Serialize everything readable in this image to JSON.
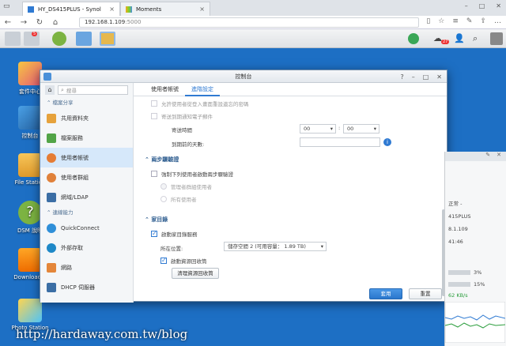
{
  "browser": {
    "tabs": [
      {
        "title": "HY_DS415PLUS - Synol"
      },
      {
        "title": "Moments"
      }
    ],
    "url_host": "192.168.1.109",
    "url_port": ":5000"
  },
  "dsm": {
    "notification_count": "5",
    "user_badge": "27"
  },
  "desktop_icons": [
    {
      "label": "套件中心"
    },
    {
      "label": "控制台"
    },
    {
      "label": "File Station"
    },
    {
      "label": "DSM 說明"
    },
    {
      "label": "Download S"
    },
    {
      "label": "Photo Station"
    }
  ],
  "window": {
    "title": "控制台",
    "search_placeholder": "搜尋",
    "sidebar": {
      "group1": "檔案分享",
      "group2": "連線能力",
      "items": [
        {
          "label": "共用資料夾"
        },
        {
          "label": "檔案服務"
        },
        {
          "label": "使用者帳號"
        },
        {
          "label": "使用者群組"
        },
        {
          "label": "網域/LDAP"
        },
        {
          "label": "QuickConnect"
        },
        {
          "label": "外部存取"
        },
        {
          "label": "網路"
        },
        {
          "label": "DHCP 伺服器"
        }
      ]
    },
    "tabs": [
      {
        "label": "使用者帳號"
      },
      {
        "label": "進階設定"
      }
    ],
    "password": {
      "option_partial": "允許使用者從登入畫面重設遺忘的密碼",
      "option_email": "寄送到期通知電子郵件",
      "send_time_label": "寄送時間",
      "hour": "00",
      "minute": "00",
      "days_before_label": "到期前的天數:"
    },
    "twostep": {
      "title": "兩步驟驗證",
      "enforce": "強制下列使用者啟動兩步驟驗證",
      "admin_group": "管理者群組使用者",
      "all_users": "所有使用者"
    },
    "home": {
      "title": "家目錄",
      "enable": "啟動家目錄服務",
      "location_label": "所在位置:",
      "location_value": "儲存空間 2 (可用容量： 1.89 TB)",
      "recycle": "啟動資源回收筒",
      "empty_btn": "清理資源回收筒"
    },
    "apply": "套用",
    "reset": "重置"
  },
  "widget": {
    "status": "正常 -",
    "model": "415PLUS",
    "ip": "8.1.109",
    "time": "41:46",
    "cpu": "3%",
    "ram": "15%",
    "net": "62 KB/s"
  },
  "watermark": "http://hardaway.com.tw/blog"
}
